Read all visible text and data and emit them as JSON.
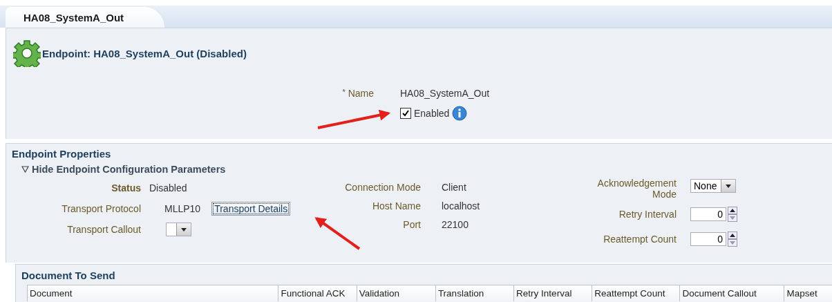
{
  "tab": {
    "label": "HA08_SystemA_Out",
    "selected": true
  },
  "header": {
    "title": "Endpoint: HA08_SystemA_Out (Disabled)"
  },
  "name_field": {
    "required_mark": "*",
    "label": "Name",
    "value": "HA08_SystemA_Out"
  },
  "enabled": {
    "label": "Enabled",
    "checked": true
  },
  "properties": {
    "title": "Endpoint Properties",
    "toggle": {
      "label": "Hide Endpoint Configuration Parameters",
      "expanded": true
    },
    "left": [
      {
        "kind": "text",
        "label": "Status",
        "value": "Disabled",
        "emphasis": true
      },
      {
        "kind": "text-button",
        "label": "Transport Protocol",
        "value": "MLLP10",
        "button": "Transport Details",
        "emphasis": false
      },
      {
        "kind": "select",
        "label": "Transport Callout",
        "emphasis": false
      }
    ],
    "middle": [
      {
        "label": "Connection Mode",
        "value": "Client"
      },
      {
        "label": "Host Name",
        "value": "localhost"
      },
      {
        "label": "Port",
        "value": "22100"
      }
    ],
    "right": [
      {
        "kind": "select",
        "label": "Acknowledgement Mode",
        "value": "None"
      },
      {
        "kind": "spinner",
        "label": "Retry Interval",
        "value": "0"
      },
      {
        "kind": "spinner",
        "label": "Reattempt Count",
        "value": "0"
      }
    ]
  },
  "document": {
    "title": "Document To Send",
    "columns": [
      "Document",
      "Functional ACK",
      "Validation",
      "Translation",
      "Retry Interval",
      "Reattempt Count",
      "Document Callout",
      "Mapset"
    ]
  }
}
